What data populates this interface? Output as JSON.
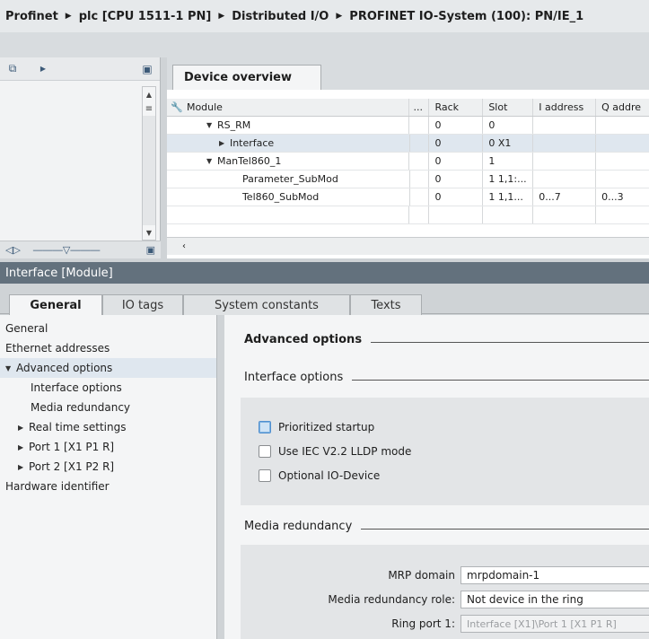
{
  "breadcrumb": [
    "Profinet",
    "plc [CPU 1511-1 PN]",
    "Distributed I/O",
    "PROFINET IO-System (100): PN/IE_1"
  ],
  "device_overview": {
    "tab_label": "Device overview",
    "columns": [
      "Module",
      "...",
      "Rack",
      "Slot",
      "I address",
      "Q addre"
    ],
    "rows": [
      {
        "arrow": "▼",
        "indent": 1,
        "module": "RS_RM",
        "rack": "0",
        "slot": "0",
        "iaddr": "",
        "qaddr": ""
      },
      {
        "arrow": "▶",
        "indent": 2,
        "module": "Interface",
        "rack": "0",
        "slot": "0 X1",
        "iaddr": "",
        "qaddr": "",
        "selected": true
      },
      {
        "arrow": "▼",
        "indent": 1,
        "module": "ManTel860_1",
        "rack": "0",
        "slot": "1",
        "iaddr": "",
        "qaddr": ""
      },
      {
        "arrow": "",
        "indent": 3,
        "module": "Parameter_SubMod",
        "rack": "0",
        "slot": "1 1,1:...",
        "iaddr": "",
        "qaddr": ""
      },
      {
        "arrow": "",
        "indent": 3,
        "module": "Tel860_SubMod",
        "rack": "0",
        "slot": "1 1,1...",
        "iaddr": "0...7",
        "qaddr": "0...3"
      },
      {
        "arrow": "",
        "indent": 0,
        "module": "",
        "rack": "",
        "slot": "",
        "iaddr": "",
        "qaddr": ""
      }
    ]
  },
  "inspector": {
    "title": "Interface [Module]",
    "tabs": [
      "General",
      "IO tags",
      "System constants",
      "Texts"
    ],
    "tree": [
      {
        "label": "General",
        "indent": 0,
        "arrow": ""
      },
      {
        "label": "Ethernet addresses",
        "indent": 0,
        "arrow": ""
      },
      {
        "label": "Advanced options",
        "indent": 0,
        "arrow": "▼",
        "selected": true
      },
      {
        "label": "Interface options",
        "indent": 2,
        "arrow": ""
      },
      {
        "label": "Media redundancy",
        "indent": 2,
        "arrow": ""
      },
      {
        "label": "Real time settings",
        "indent": 1,
        "arrow": "▶"
      },
      {
        "label": "Port 1 [X1 P1 R]",
        "indent": 1,
        "arrow": "▶"
      },
      {
        "label": "Port 2 [X1 P2 R]",
        "indent": 1,
        "arrow": "▶"
      },
      {
        "label": "Hardware identifier",
        "indent": 0,
        "arrow": ""
      }
    ],
    "sections": {
      "advanced": "Advanced options",
      "interface": "Interface options",
      "media": "Media redundancy"
    },
    "checkboxes": [
      "Prioritized startup",
      "Use IEC V2.2 LLDP mode",
      "Optional IO-Device"
    ],
    "fields": {
      "mrp_domain_label": "MRP domain",
      "mrp_domain_value": "mrpdomain-1",
      "role_label": "Media redundancy role:",
      "role_value": "Not device in the ring",
      "ring_port_label": "Ring port 1:",
      "ring_port_value": "Interface [X1]\\Port 1 [X1 P1 R]"
    }
  }
}
